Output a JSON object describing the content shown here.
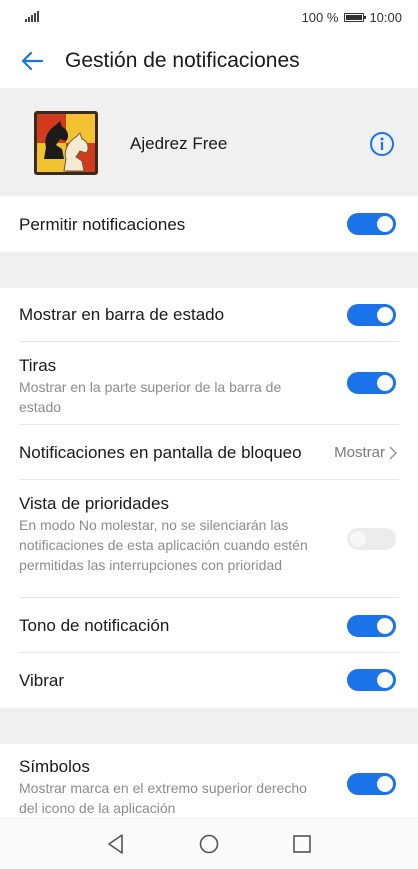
{
  "status_bar": {
    "battery_percent": "100 %",
    "time": "10:00"
  },
  "app_bar": {
    "title": "Gestión de notificaciones"
  },
  "app": {
    "name": "Ajedrez Free"
  },
  "settings": {
    "allow": {
      "title": "Permitir notificaciones",
      "enabled": true
    },
    "status_bar": {
      "title": "Mostrar en barra de estado",
      "enabled": true
    },
    "banners": {
      "title": "Tiras",
      "subtitle": "Mostrar en la parte superior de la barra de estado",
      "enabled": true
    },
    "lock_screen": {
      "title": "Notificaciones en pantalla de bloqueo",
      "value": "Mostrar"
    },
    "priority": {
      "title": "Vista de prioridades",
      "subtitle": "En modo No molestar, no se silenciarán las notificaciones de esta aplicación cuando estén permitidas las interrupciones con prioridad",
      "enabled": false
    },
    "tone": {
      "title": "Tono de notificación",
      "enabled": true
    },
    "vibrate": {
      "title": "Vibrar",
      "enabled": true
    },
    "badges": {
      "title": "Símbolos",
      "subtitle": "Mostrar marca en el extremo superior derecho del icono de la aplicación",
      "enabled": true
    }
  },
  "colors": {
    "accent": "#1a73e8",
    "section_background": "#f0f0f0"
  },
  "icons": {
    "back": "arrow-left-icon",
    "info": "info-circle-icon",
    "nav_back": "triangle-back-icon",
    "nav_home": "circle-home-icon",
    "nav_recent": "square-recent-icon"
  }
}
